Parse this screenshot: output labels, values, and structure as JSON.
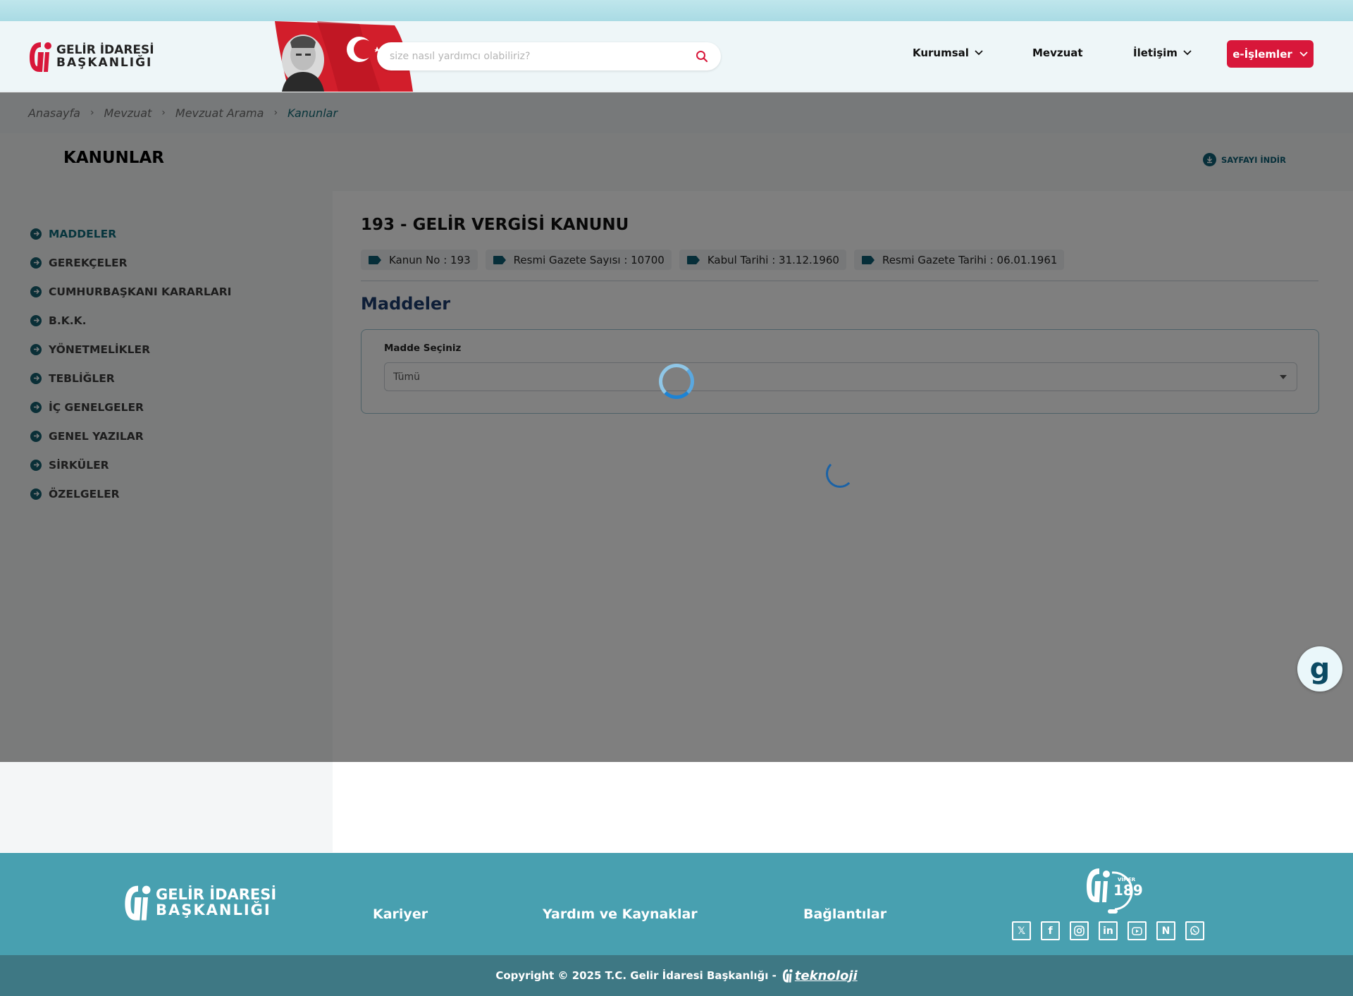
{
  "header": {
    "logo_line1": "GELİR İDARESİ",
    "logo_line2": "BAŞKANLIĞI",
    "search_placeholder": "size nasıl yardımcı olabiliriz?",
    "nav": {
      "kurumsal": "Kurumsal",
      "mevzuat": "Mevzuat",
      "iletisim": "İletişim",
      "eislemler": "e-İşlemler"
    },
    "accent_color": "#d8173a"
  },
  "breadcrumb": [
    "Anasayfa",
    "Mevzuat",
    "Mevzuat Arama",
    "Kanunlar"
  ],
  "page": {
    "title": "KANUNLAR",
    "download_label": "SAYFAYI İNDİR"
  },
  "sidebar": {
    "items": [
      {
        "label": "MADDELER",
        "active": true
      },
      {
        "label": "GEREKÇELER",
        "active": false
      },
      {
        "label": "CUMHURBAŞKANI KARARLARI",
        "active": false
      },
      {
        "label": "B.K.K.",
        "active": false
      },
      {
        "label": "YÖNETMELİKLER",
        "active": false
      },
      {
        "label": "TEBLİĞLER",
        "active": false
      },
      {
        "label": "İÇ GENELGELER",
        "active": false
      },
      {
        "label": "GENEL YAZILAR",
        "active": false
      },
      {
        "label": "SİRKÜLER",
        "active": false
      },
      {
        "label": "ÖZELGELER",
        "active": false
      }
    ]
  },
  "law": {
    "title": "193 - GELİR VERGİSİ KANUNU",
    "tags": [
      "Kanun No : 193",
      "Resmi Gazete Sayısı : 10700",
      "Kabul Tarihi : 31.12.1960",
      "Resmi Gazete Tarihi : 06.01.1961"
    ],
    "section_title": "Maddeler",
    "madde_label": "Madde Seçiniz",
    "madde_value": "Tümü"
  },
  "assistant_glyph": "g",
  "footer": {
    "logo_line1": "GELİR İDARESİ",
    "logo_line2": "BAŞKANLIĞI",
    "links": {
      "kariyer": "Kariyer",
      "yardim": "Yardım ve Kaynaklar",
      "baglantilar": "Bağlantılar"
    },
    "vimer_number": "189",
    "vimer_label": "VİMER",
    "socials": [
      "x-icon",
      "facebook-icon",
      "instagram-icon",
      "linkedin-icon",
      "youtube-icon",
      "nsosyal-icon",
      "whatsapp-icon"
    ],
    "copyright": "Copyright © 2025 T.C. Gelir İdaresi Başkanlığı -",
    "teknoloji": "teknoloji"
  }
}
